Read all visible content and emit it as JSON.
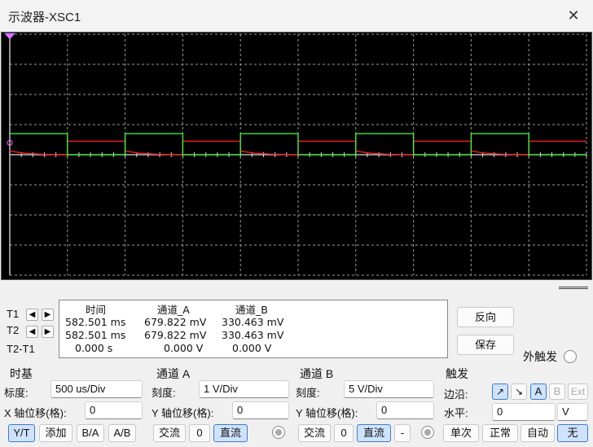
{
  "window": {
    "title": "示波器-XSC1",
    "close_icon": "close-icon"
  },
  "colors": {
    "channel_a": "#ff2020",
    "channel_b": "#40ff40",
    "grid": "#9a9a9a",
    "screen_bg": "#000000",
    "accent": "#3a7bd5"
  },
  "measure": {
    "row_t1": "T1",
    "row_t2": "T2",
    "row_diff": "T2-T1",
    "col_time": "时间",
    "col_a": "通道_A",
    "col_b": "通道_B",
    "t1_time": "582.501 ms",
    "t1_a": "679.822 mV",
    "t1_b": "330.463 mV",
    "t2_time": "582.501 ms",
    "t2_a": "679.822 mV",
    "t2_b": "330.463 mV",
    "d_time": "0.000 s",
    "d_a": "0.000 V",
    "d_b": "0.000 V"
  },
  "actions": {
    "reverse": "反向",
    "save": "保存",
    "ext_trigger": "外触发"
  },
  "timebase": {
    "title": "时基",
    "scale_label": "标度:",
    "scale_value": "500 us/Div",
    "xpos_label": "X 轴位移(格):",
    "xpos_value": "0",
    "modes": [
      "Y/T",
      "添加",
      "B/A",
      "A/B"
    ]
  },
  "channel_a": {
    "title": "通道 A",
    "scale_label": "刻度:",
    "scale_value": "1  V/Div",
    "ypos_label": "Y 轴位移(格):",
    "ypos_value": "0",
    "coupling": [
      "交流",
      "0",
      "直流"
    ]
  },
  "channel_b": {
    "title": "通道 B",
    "scale_label": "刻度:",
    "scale_value": "5  V/Div",
    "ypos_label": "Y 轴位移(格):",
    "ypos_value": "0",
    "coupling": [
      "交流",
      "0",
      "直流",
      "-"
    ]
  },
  "trigger": {
    "title": "触发",
    "edge_label": "边沿:",
    "level_label": "水平:",
    "level_value": "0",
    "level_unit": "V",
    "sources": [
      "A",
      "B",
      "Ext"
    ],
    "modes": [
      "单次",
      "正常",
      "自动",
      "无"
    ]
  },
  "chart_data": {
    "type": "line",
    "title": "",
    "xlabel": "",
    "ylabel": "",
    "xlim": [
      0,
      10
    ],
    "ylim": [
      -4,
      4
    ],
    "grid": true,
    "series": [
      {
        "values": [
          [
            0,
            0.45
          ],
          [
            1,
            0.45
          ],
          [
            1,
            0.45
          ],
          [
            2,
            0.45
          ]
        ]
      },
      {
        "values": [
          [
            0,
            0.7
          ],
          [
            1,
            0.7
          ],
          [
            1,
            0.0
          ],
          [
            2,
            0.0
          ],
          [
            2,
            0.7
          ]
        ]
      }
    ]
  }
}
